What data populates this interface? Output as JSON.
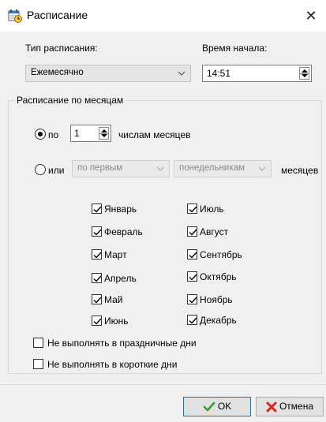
{
  "window": {
    "title": "Расписание",
    "close_glyph": "✕"
  },
  "schedule_type": {
    "label": "Тип расписания:",
    "value": "Ежемесячно"
  },
  "start_time": {
    "label": "Время начала:",
    "value": "14:51"
  },
  "group": {
    "title": "Расписание по месяцам",
    "option_days": {
      "label": "по",
      "value": "1",
      "suffix": "числам месяцев",
      "selected": true
    },
    "option_weekday": {
      "label": "или",
      "ordinal": "по первым",
      "weekday": "понедельникам",
      "suffix": "месяцев",
      "selected": false
    },
    "months": [
      {
        "label": "Январь",
        "checked": true
      },
      {
        "label": "Февраль",
        "checked": true
      },
      {
        "label": "Март",
        "checked": true
      },
      {
        "label": "Апрель",
        "checked": true
      },
      {
        "label": "Май",
        "checked": true
      },
      {
        "label": "Июнь",
        "checked": true
      },
      {
        "label": "Июль",
        "checked": true
      },
      {
        "label": "Август",
        "checked": true
      },
      {
        "label": "Сентябрь",
        "checked": true
      },
      {
        "label": "Октябрь",
        "checked": true
      },
      {
        "label": "Ноябрь",
        "checked": true
      },
      {
        "label": "Декабрь",
        "checked": true
      }
    ],
    "skip_holidays": {
      "label": "Не выполнять в праздничные дни",
      "checked": false
    },
    "skip_short_days": {
      "label": "Не выполнять в короткие дни",
      "checked": false
    }
  },
  "buttons": {
    "ok": "OK",
    "cancel": "Отмена"
  },
  "colors": {
    "ok_check": "#2e9e2e",
    "cancel_x": "#d9261c",
    "focus_border": "#0078d7"
  }
}
